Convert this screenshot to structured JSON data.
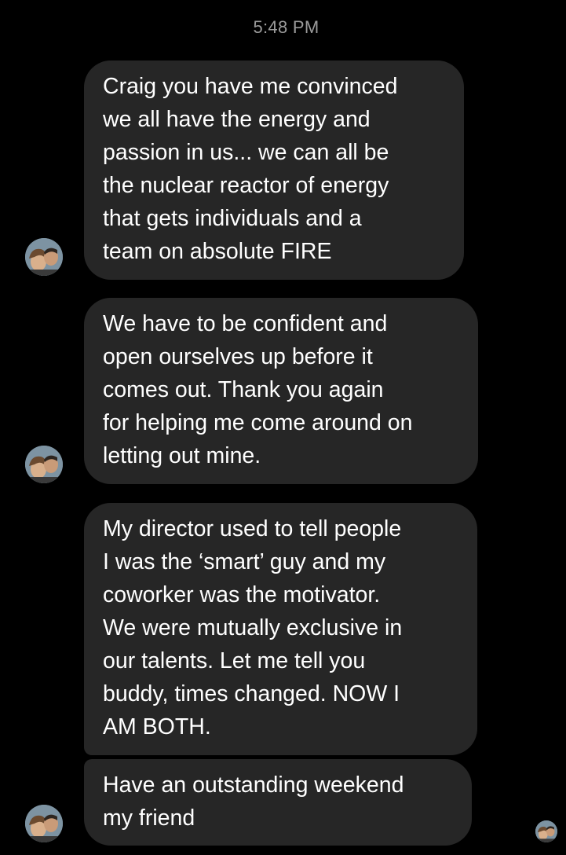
{
  "thread": {
    "timestamp": "5:48 PM",
    "messages": [
      {
        "text": "Craig you have me convinced\nwe all have the energy and\npassion in us... we can all be\nthe nuclear reactor of energy\nthat gets individuals and a\nteam on absolute FIRE"
      },
      {
        "text": "We have to be confident and\nopen ourselves up before it\ncomes out. Thank you again\nfor helping me come around on\nletting out mine."
      },
      {
        "text": "My director used to tell people\nI was the ‘smart’ guy and my\ncoworker was the motivator.\nWe were mutually exclusive in\nour talents. Let me tell you\nbuddy, times changed. NOW I\nAM BOTH."
      },
      {
        "text": "Have an outstanding weekend\nmy friend"
      }
    ]
  },
  "colors": {
    "background": "#000000",
    "bubble": "#262626",
    "text": "#ffffff",
    "timestamp": "#9b9b9b"
  },
  "icons": {
    "sender_avatar": "sender-avatar-photo",
    "seen_indicator": "seen-avatar-photo"
  }
}
